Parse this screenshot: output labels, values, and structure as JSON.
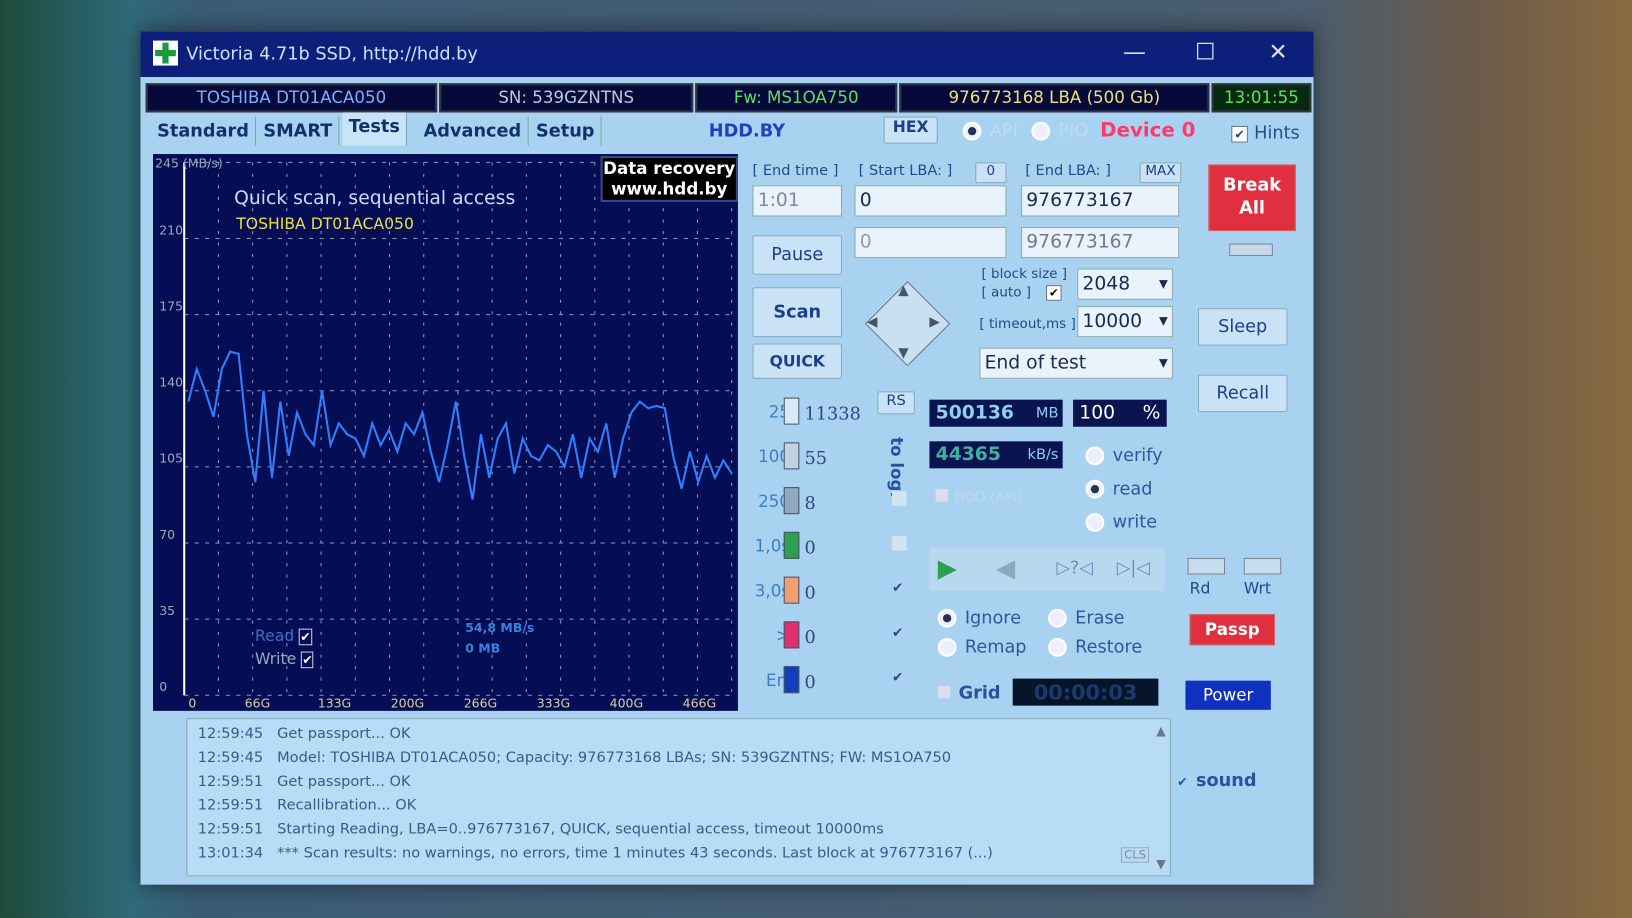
{
  "window": {
    "title": "Victoria 4.71b SSD, http://hdd.by",
    "minimize": "—",
    "maximize": "☐",
    "close": "✕"
  },
  "info": {
    "model": "TOSHIBA DT01ACA050",
    "serial": "SN: 539GZNTNS",
    "firmware": "Fw: MS1OA750",
    "capacity": "976773168 LBA (500 Gb)",
    "clock": "13:01:55"
  },
  "tabs": [
    {
      "label": "Standard"
    },
    {
      "label": "SMART"
    },
    {
      "label": "Tests",
      "active": true
    },
    {
      "label": "Advanced"
    },
    {
      "label": "Setup"
    }
  ],
  "toolbar": {
    "site": "HDD.BY",
    "hex": "HEX",
    "api": "API",
    "pio": "PIO",
    "device": "Device 0",
    "hints": "Hints",
    "hints_checked": true
  },
  "graph": {
    "ylabel": "245 (MB/s)",
    "title": "Quick scan, sequential access",
    "model": "TOSHIBA DT01ACA050",
    "recovery1": "Data recovery",
    "recovery2": "www.hdd.by",
    "read_label": "Read",
    "write_label": "Write",
    "speed": "54,8 MB/s",
    "written": "0 MB"
  },
  "chart_data": {
    "type": "line",
    "ylim": [
      0,
      245
    ],
    "yticks": [
      "210",
      "175",
      "140",
      "105",
      "70",
      "35",
      "0"
    ],
    "xticks": [
      "66G",
      "133G",
      "200G",
      "266G",
      "333G",
      "400G",
      "466G"
    ],
    "grid": true,
    "color": "#2f7fff",
    "values": [
      135,
      150,
      140,
      128,
      150,
      158,
      157,
      120,
      98,
      140,
      100,
      135,
      110,
      130,
      120,
      115,
      140,
      115,
      125,
      120,
      118,
      110,
      125,
      115,
      122,
      112,
      125,
      120,
      130,
      112,
      98,
      115,
      135,
      110,
      90,
      120,
      100,
      118,
      125,
      102,
      118,
      110,
      108,
      115,
      112,
      105,
      120,
      100,
      118,
      112,
      125,
      100,
      118,
      130,
      135,
      132,
      133,
      132,
      110,
      95,
      112,
      98,
      110,
      100,
      108,
      102
    ]
  },
  "controls": {
    "end_time_label": "[ End time ]",
    "end_time": "1:01",
    "start_lba_label": "[ Start LBA: ]",
    "start_lba_btn": "0",
    "end_lba_label": "[ End LBA: ]",
    "max": "MAX",
    "start_lba": "0",
    "end_lba": "976773167",
    "cur_lba": "0",
    "cur_end_lba": "976773167",
    "pause": "Pause",
    "scan": "Scan",
    "quick": "QUICK",
    "block_size_label": "[ block size ]",
    "auto_label": "[ auto ]",
    "block_size": "2048",
    "timeout_label": "[ timeout,ms ]",
    "timeout": "10000",
    "end_action": "End of test"
  },
  "stats": {
    "rs": "RS",
    "to_log": "to log:",
    "rows": [
      {
        "label": "25",
        "count": "11338",
        "color": "#d8e8f4"
      },
      {
        "label": "100",
        "count": "55",
        "color": "#c0d4e4"
      },
      {
        "label": "250",
        "count": "8",
        "color": "#90a8c0"
      },
      {
        "label": "1,0s",
        "count": "0",
        "color": "#2aa050"
      },
      {
        "label": "3,0s",
        "count": "0",
        "color": "#f0a070"
      },
      {
        "label": ">",
        "count": "0",
        "color": "#e03070"
      },
      {
        "label": "Err",
        "count": "0",
        "color": "#1040c0"
      }
    ]
  },
  "progress": {
    "mb": "500136",
    "mb_unit": "MB",
    "percent": "100",
    "percent_unit": "%",
    "speed": "44365",
    "speed_unit": "kB/s",
    "ddd": "DDD (API)"
  },
  "mode": {
    "verify": "verify",
    "read": "read",
    "write": "write",
    "selected": "read"
  },
  "actions": {
    "ignore": "Ignore",
    "erase": "Erase",
    "remap": "Remap",
    "restore": "Restore",
    "selected": "Ignore",
    "grid": "Grid",
    "timer": "00:00:03"
  },
  "side": {
    "break": "Break All",
    "sleep": "Sleep",
    "recall": "Recall",
    "rd": "Rd",
    "wrt": "Wrt",
    "passp": "Passp",
    "power": "Power",
    "sound": "sound"
  },
  "log": [
    {
      "time": "12:59:45",
      "msg": "Get passport... OK"
    },
    {
      "time": "12:59:45",
      "msg": "Model: TOSHIBA DT01ACA050; Capacity: 976773168 LBAs; SN: 539GZNTNS; FW: MS1OA750"
    },
    {
      "time": "12:59:51",
      "msg": "Get passport... OK"
    },
    {
      "time": "12:59:51",
      "msg": "Recallibration... OK"
    },
    {
      "time": "12:59:51",
      "msg": "Starting Reading, LBA=0..976773167, QUICK, sequential access, timeout 10000ms"
    },
    {
      "time": "13:01:34",
      "msg": "*** Scan results: no warnings, no errors, time 1 minutes 43 seconds. Last block at 976773167 (...)"
    }
  ],
  "log_cls": "CLS"
}
